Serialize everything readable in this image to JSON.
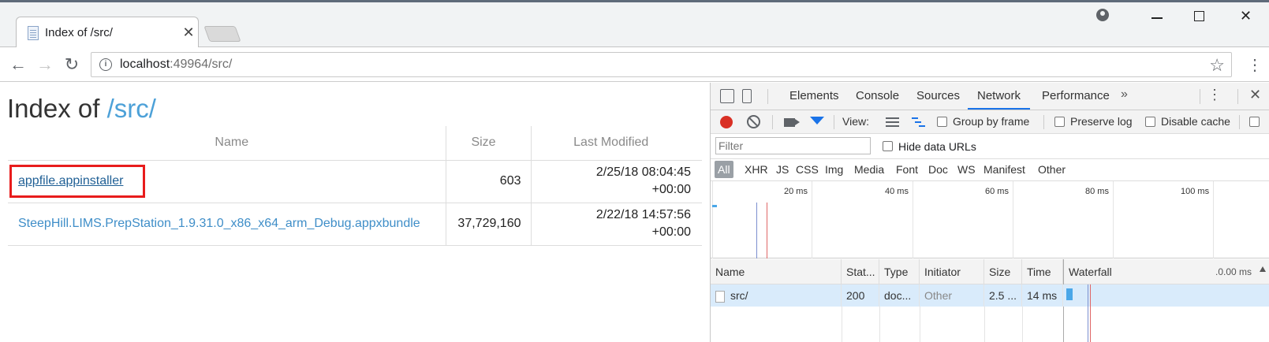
{
  "browser": {
    "tab_title": "Index of /src/",
    "url_host": "localhost",
    "url_rest": ":49964/src/"
  },
  "page": {
    "title_prefix": "Index of ",
    "title_path": "/src/",
    "columns": {
      "name": "Name",
      "size": "Size",
      "modified": "Last Modified"
    },
    "files": [
      {
        "name": "appfile.appinstaller",
        "size": "603",
        "date": "2/25/18 08:04:45",
        "tz": "+00:00"
      },
      {
        "name": "SteepHill.LIMS.PrepStation_1.9.31.0_x86_x64_arm_Debug.appxbundle",
        "size": "37,729,160",
        "date": "2/22/18 14:57:56",
        "tz": "+00:00"
      }
    ]
  },
  "devtools": {
    "tabs": [
      "Elements",
      "Console",
      "Sources",
      "Network",
      "Performance"
    ],
    "active_tab": "Network",
    "more_tabs": "»",
    "toolbar": {
      "view_label": "View:",
      "group_by_frame": "Group by frame",
      "preserve_log": "Preserve log",
      "disable_cache": "Disable cache"
    },
    "filter_placeholder": "Filter",
    "hide_data_urls": "Hide data URLs",
    "types": [
      "All",
      "XHR",
      "JS",
      "CSS",
      "Img",
      "Media",
      "Font",
      "Doc",
      "WS",
      "Manifest",
      "Other"
    ],
    "overview_ticks": [
      "20 ms",
      "40 ms",
      "60 ms",
      "80 ms",
      "100 ms"
    ],
    "grid_columns": [
      "Name",
      "Stat...",
      "Type",
      "Initiator",
      "Size",
      "Time",
      "Waterfall"
    ],
    "waterfall_time": ".0.00 ms",
    "requests": [
      {
        "name": "src/",
        "status": "200",
        "type": "doc...",
        "initiator": "Other",
        "size": "2.5 ...",
        "time": "14 ms"
      }
    ]
  },
  "colors": {
    "accent": "#1a73e8",
    "link": "#3f8ec8",
    "record": "#d93025",
    "highlight": "#e81c1c"
  }
}
